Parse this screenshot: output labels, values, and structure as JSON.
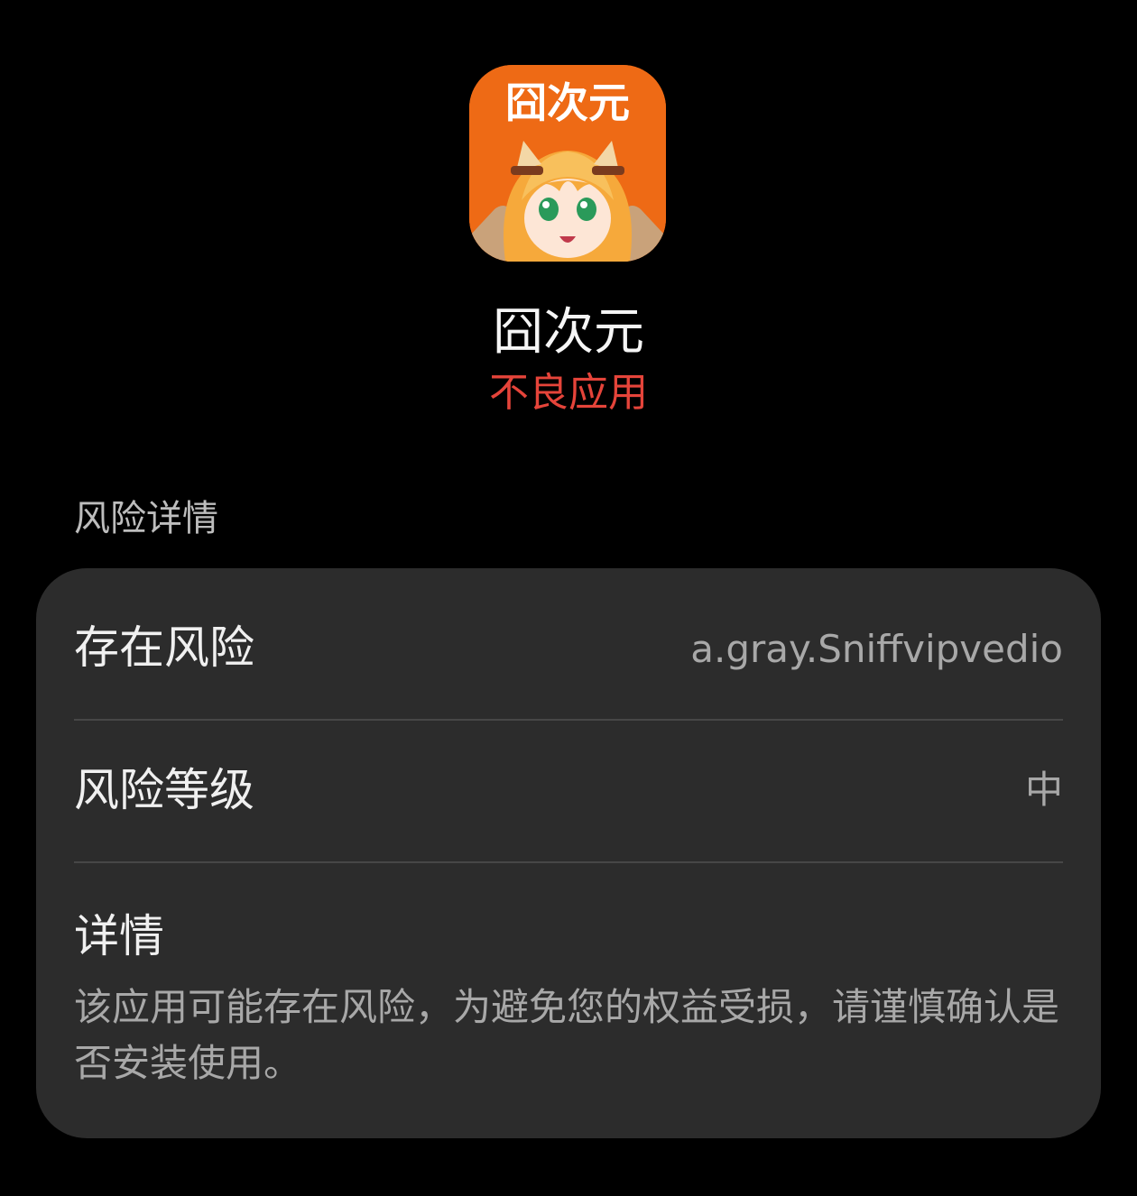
{
  "app": {
    "icon_name": "app-logo-icon",
    "icon_text": "囧次元",
    "name": "囧次元",
    "status": "不良应用",
    "status_color": "#e5443a"
  },
  "risk": {
    "section_title": "风险详情",
    "exists_label": "存在风险",
    "exists_value": "a.gray.Sniffvipvedio",
    "level_label": "风险等级",
    "level_value": "中",
    "details_label": "详情",
    "details_text": "该应用可能存在风险，为避免您的权益受损，请谨慎确认是否安装使用。"
  },
  "colors": {
    "background": "#000000",
    "card": "#2c2c2c",
    "icon_bg": "#ee6a15"
  }
}
